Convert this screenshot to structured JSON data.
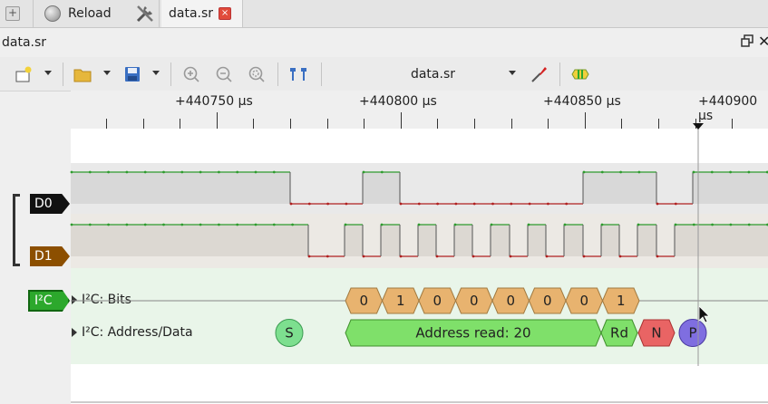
{
  "tabs": [
    {
      "label": "Reload"
    },
    {
      "label": "data.sr",
      "close": "×"
    }
  ],
  "add_tab": "+",
  "document_title": "data.sr",
  "window_close": "✕",
  "toolbar": {
    "session_name": "data.sr"
  },
  "ruler": {
    "labels": [
      "+440750 µs",
      "+440800 µs",
      "+440850 µs",
      "+440900 µs"
    ]
  },
  "channels": [
    {
      "name": "D0",
      "color": "#111111"
    },
    {
      "name": "D1",
      "color": "#8c4f00"
    }
  ],
  "decoder": {
    "label": "I²C",
    "color": "#2ca82c",
    "rows": [
      {
        "name": "I²C: Bits"
      },
      {
        "name": "I²C: Address/Data"
      }
    ],
    "bits": [
      "0",
      "1",
      "0",
      "0",
      "0",
      "0",
      "0",
      "1"
    ],
    "annotations": {
      "start": "S",
      "address": "Address read: 20",
      "rw": "Rd",
      "nack": "N",
      "stop": "P"
    },
    "colors": {
      "bits": "#e8b36f",
      "start": "#7ddf8f",
      "address": "#7fe06a",
      "nack": "#e96464",
      "stop": "#7f6ee0"
    }
  },
  "colors": {
    "signal_high": "#2e9c2e",
    "signal_low": "#b02020"
  }
}
